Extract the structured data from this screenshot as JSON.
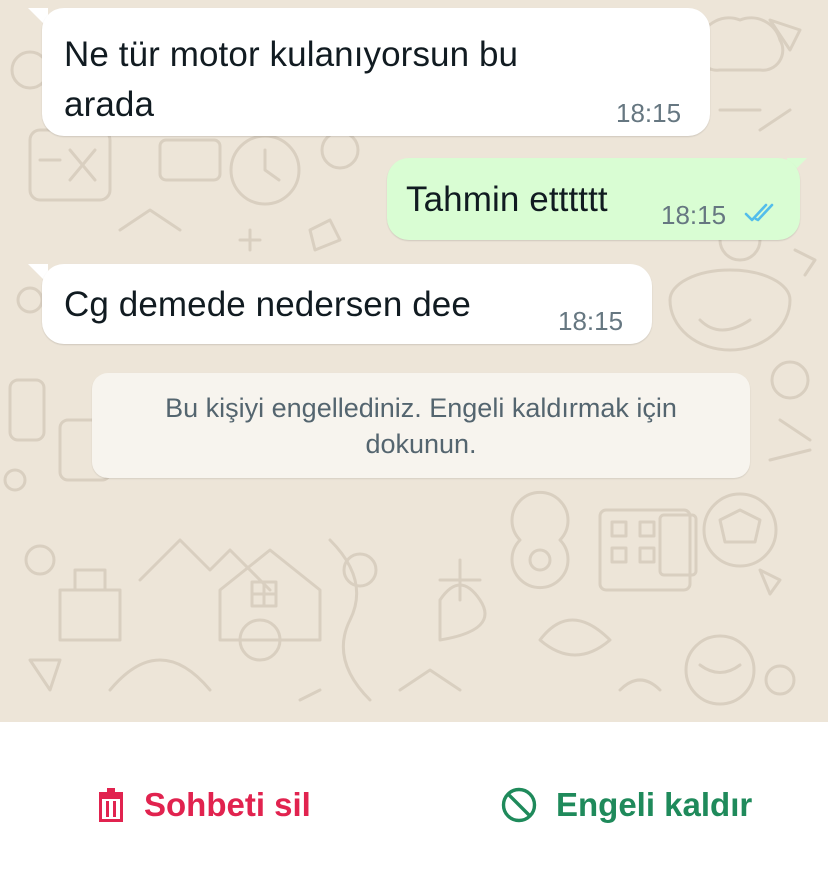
{
  "messages": [
    {
      "direction": "incoming",
      "text_line1": "Ne tür motor kulanıyorsun bu",
      "text_line2": "arada",
      "time": "18:15"
    },
    {
      "direction": "outgoing",
      "text": "Tahmin etttttt",
      "time": "18:15",
      "status": "read"
    },
    {
      "direction": "incoming",
      "text": "Cg demede nedersen dee",
      "time": "18:15"
    }
  ],
  "system_notice": {
    "line1": "Bu kişiyi engellediniz. Engeli kaldırmak için",
    "line2": "dokunun."
  },
  "actions": {
    "delete_chat": {
      "label": "Sohbeti sil",
      "icon": "trash-icon",
      "color": "#e1234f"
    },
    "unblock": {
      "label": "Engeli kaldır",
      "icon": "block-icon",
      "color": "#1f8a5b"
    }
  },
  "colors": {
    "incoming_bubble": "#ffffff",
    "outgoing_bubble": "#d9fdd3",
    "read_ticks": "#53bdeb",
    "chat_background": "#ede5d8"
  }
}
